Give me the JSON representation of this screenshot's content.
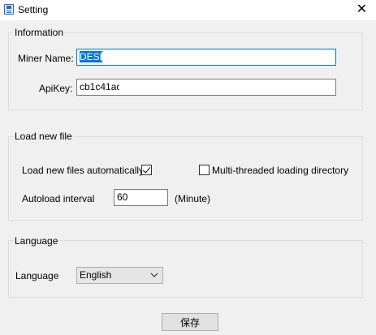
{
  "window": {
    "title": "Setting",
    "close_glyph": "✕",
    "icon": "save-floppy-icon"
  },
  "information": {
    "legend": "Information",
    "miner_name_label": "Miner Name:",
    "miner_name_value_selected": "DESK",
    "miner_name_value_rest": "",
    "apikey_label": "ApiKey:",
    "apikey_value": "cb1c41ac"
  },
  "load_new_file": {
    "legend": "Load new file",
    "auto_load_label": "Load new files automatically",
    "auto_load_checked": true,
    "multi_thread_label": "Multi-threaded loading directory",
    "multi_thread_checked": false,
    "interval_label": "Autoload interval",
    "interval_value": "60",
    "interval_unit": "(Minute)"
  },
  "language_section": {
    "legend": "Language",
    "language_label": "Language",
    "language_selected": "English"
  },
  "footer": {
    "save_label": "保存"
  },
  "colors": {
    "selection": "#0078d7",
    "window_bg": "#f0f0f0"
  }
}
